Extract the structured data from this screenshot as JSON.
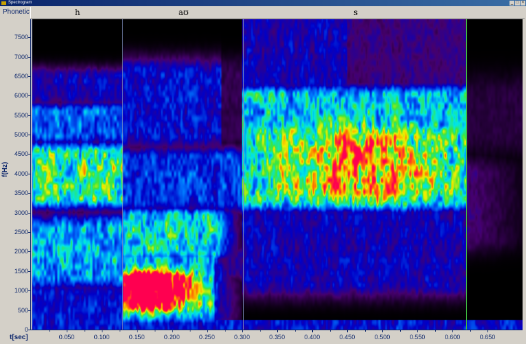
{
  "window": {
    "title": "Spectrogram",
    "buttons": [
      "_",
      "□",
      "×"
    ]
  },
  "phonetic": {
    "label": "Phonetic",
    "segments": [
      {
        "label": "h",
        "start": 0.0,
        "end": 0.129,
        "boundary_color": "#8090c0"
      },
      {
        "label": "aʊ",
        "start": 0.129,
        "end": 0.302,
        "boundary_color": "#8090c0"
      },
      {
        "label": "s",
        "start": 0.302,
        "end": 0.62,
        "boundary_color": "#40c040"
      }
    ]
  },
  "y_axis": {
    "title": "f(Hz)",
    "max": 8000,
    "ticks": [
      "0",
      "500",
      "1000",
      "1500",
      "2000",
      "2500",
      "3000",
      "3500",
      "4000",
      "4500",
      "5000",
      "5500",
      "6000",
      "6500",
      "7000",
      "7500"
    ]
  },
  "x_axis": {
    "title": "t[sec]",
    "max": 0.7,
    "ticks": [
      "0.050",
      "0.100",
      "0.150",
      "0.200",
      "0.250",
      "0.300",
      "0.350",
      "0.400",
      "0.450",
      "0.500",
      "0.550",
      "0.600",
      "0.650"
    ]
  }
}
